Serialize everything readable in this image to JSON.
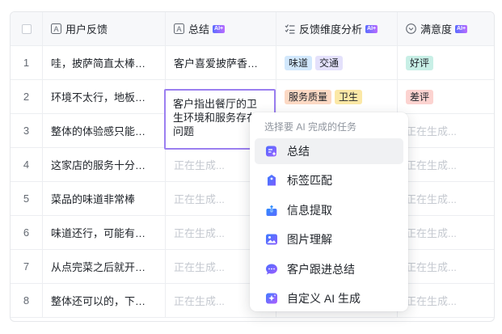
{
  "table": {
    "headers": {
      "feedback": "用户反馈",
      "summary": "总结",
      "dimension": "反馈维度分析",
      "satisfaction": "满意度",
      "ai_badge": "AI+"
    },
    "generating_text": "正在生成...",
    "rows": [
      {
        "num": "1",
        "feedback": "哇，披萨简直太棒…",
        "summary": "客户喜爱披萨香…",
        "tags": [
          "味道",
          "交通"
        ],
        "satisfaction": "好评"
      },
      {
        "num": "2",
        "feedback": "环境不太行，地板…",
        "summary": "",
        "tags": [
          "服务质量",
          "卫生"
        ],
        "satisfaction": "差评"
      },
      {
        "num": "3",
        "feedback": "整体的体验感只能…",
        "summary": "",
        "tags": [],
        "satisfaction": ""
      },
      {
        "num": "4",
        "feedback": "这家店的服务十分…",
        "summary": "",
        "tags": [],
        "satisfaction": ""
      },
      {
        "num": "5",
        "feedback": "菜品的味道非常棒",
        "summary": "",
        "tags": [],
        "satisfaction": ""
      },
      {
        "num": "6",
        "feedback": "味道还行，可能有…",
        "summary": "",
        "tags": [],
        "satisfaction": ""
      },
      {
        "num": "7",
        "feedback": "从点完菜之后就开…",
        "summary": "",
        "tags": [],
        "satisfaction": ""
      },
      {
        "num": "8",
        "feedback": "整体还可以的，下…",
        "summary": "",
        "tags": [],
        "satisfaction": ""
      }
    ],
    "editing_cell_text": "客户指出餐厅的卫生环境和服务存在问题"
  },
  "menu": {
    "title": "选择要 AI 完成的任务",
    "items": [
      {
        "label": "总结",
        "icon": "summary-icon",
        "active": true
      },
      {
        "label": "标签匹配",
        "icon": "tag-match-icon"
      },
      {
        "label": "信息提取",
        "icon": "extract-icon"
      },
      {
        "label": "图片理解",
        "icon": "image-understand-icon"
      },
      {
        "label": "客户跟进总结",
        "icon": "chat-summary-icon"
      },
      {
        "label": "自定义 AI 生成",
        "icon": "custom-ai-icon"
      }
    ]
  },
  "colors": {
    "accent": "#9b7ff0",
    "tag_blue": "#d2e8fc",
    "tag_purple": "#e4e1fb",
    "tag_orange": "#fcd9c4",
    "tag_yellow": "#fbe8a6",
    "tag_green": "#c8efe6",
    "tag_red": "#fcd3d0"
  }
}
